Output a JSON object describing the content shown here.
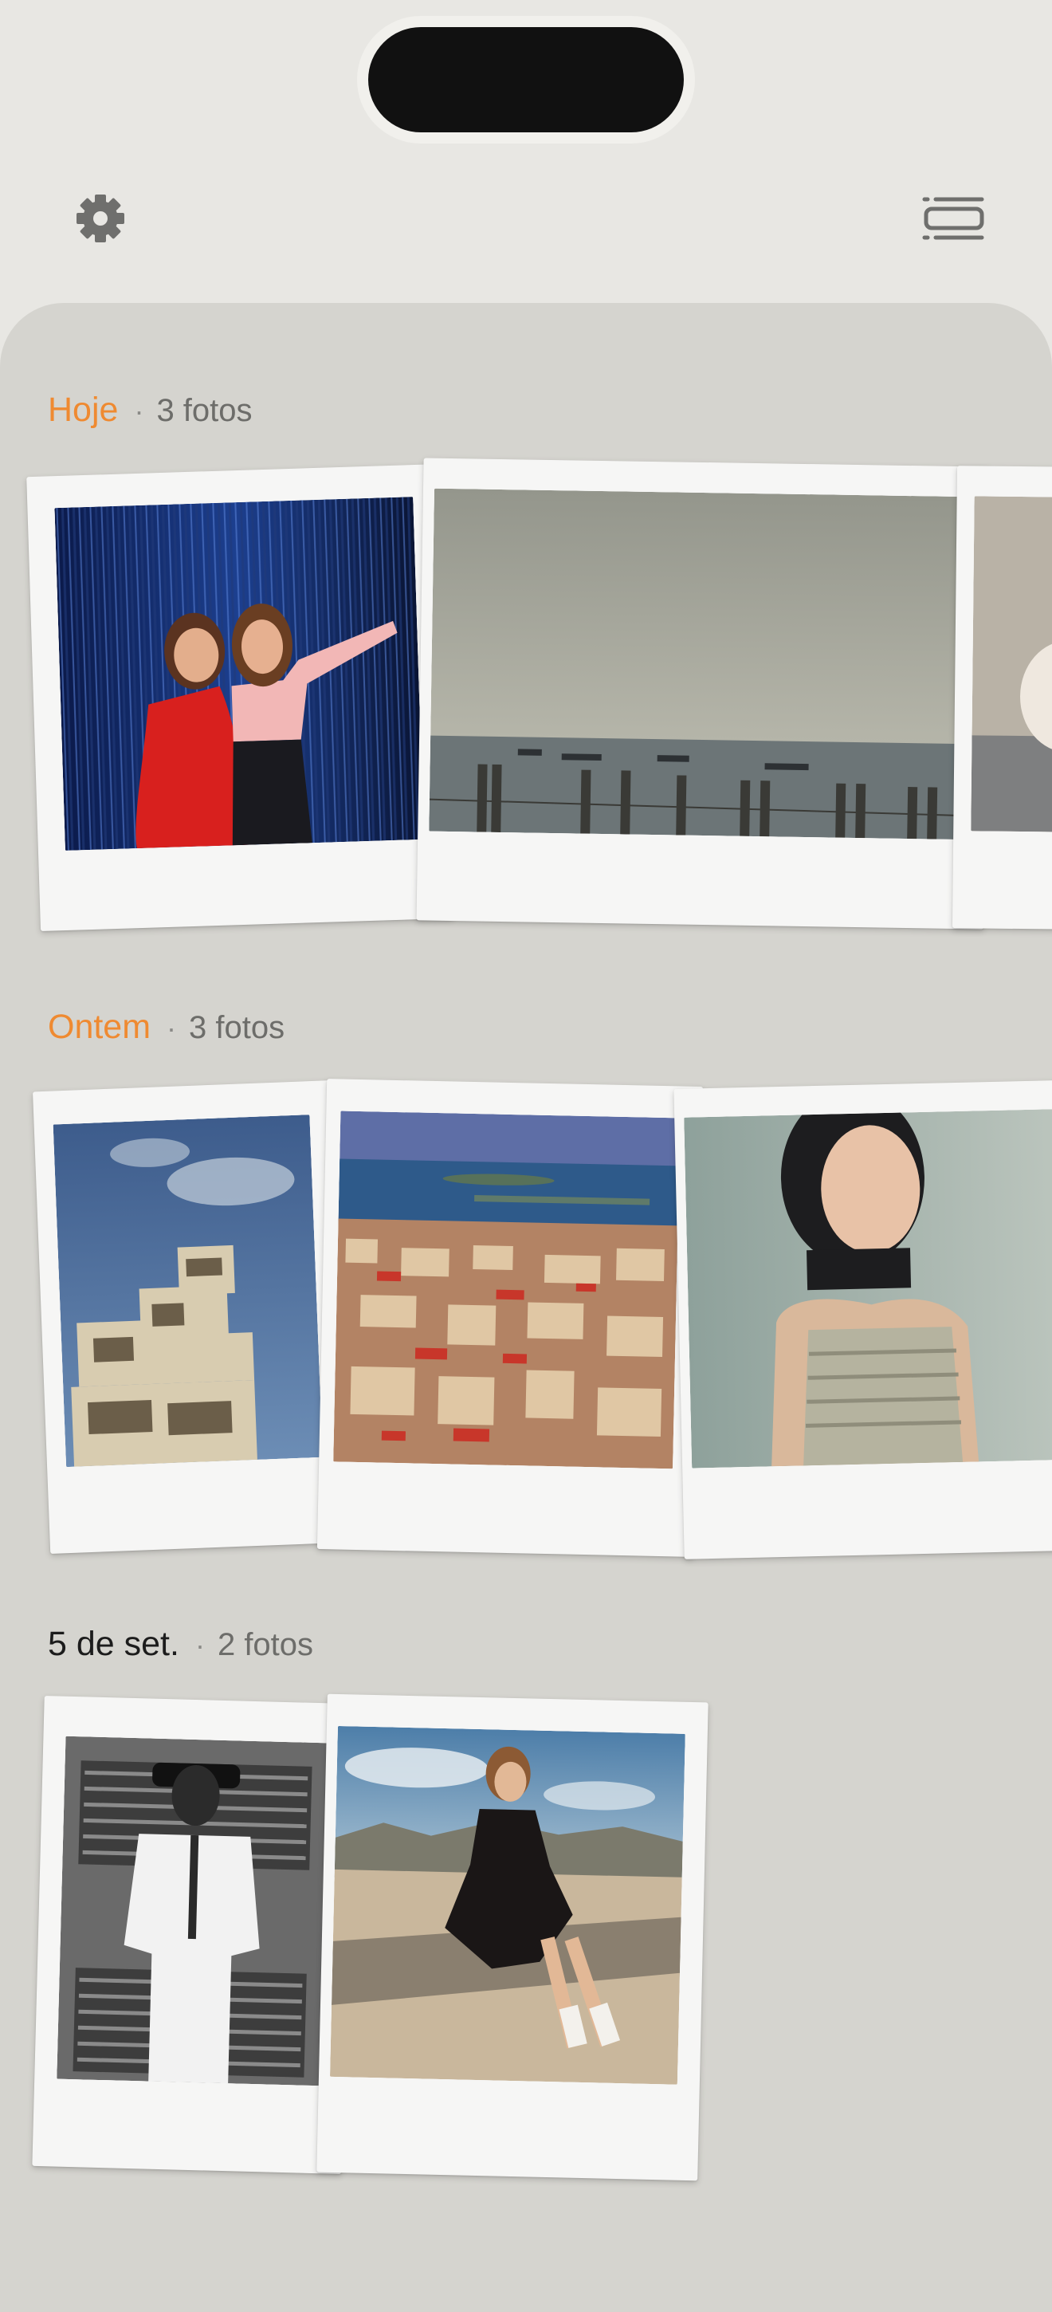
{
  "toolbar": {
    "settings_icon": "gear-icon",
    "layout_icon": "list-layout-icon"
  },
  "sections": [
    {
      "title": "Hoje",
      "separator": "·",
      "count": "3 fotos",
      "color": "#ef8a31",
      "photos": [
        "two women in red and pink dresses",
        "grey sea with boats",
        "white cat"
      ]
    },
    {
      "title": "Ontem",
      "separator": "·",
      "count": "3 fotos",
      "color": "#ef8a31",
      "photos": [
        "concrete building against blue sky",
        "coastal town with sea",
        "young woman in shadows"
      ]
    },
    {
      "title": "5 de set.",
      "separator": "·",
      "count": "2 fotos",
      "color": "#1c1c1c",
      "photos": [
        "man in white suit black and white",
        "woman in black dress sitting on wall"
      ]
    }
  ],
  "colors": {
    "accent": "#ef8a31",
    "background": "#e8e7e3",
    "panel": "#d5d4cf"
  }
}
